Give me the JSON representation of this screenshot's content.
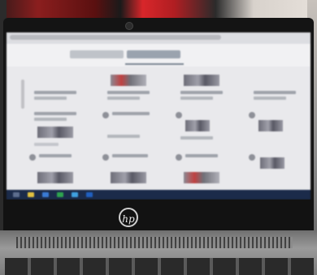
{
  "photo": {
    "subject": "laptop-screen",
    "colors": {
      "fabric_red": "#d8262a",
      "bezel": "#141414",
      "screen_bg": "#e9e9ec",
      "taskbar": "#1b2b4a"
    }
  },
  "laptop": {
    "logo_text": "hp"
  },
  "screen": {
    "cards": [
      {
        "icon": "thumbnail",
        "style": "plain"
      },
      {
        "icon": "thumbnail",
        "style": "red"
      },
      {
        "icon": "thumbnail",
        "style": "plain"
      },
      {
        "icon": "thumbnail",
        "style": "plain"
      },
      {
        "icon": "avatar",
        "style": "plain"
      },
      {
        "icon": "avatar",
        "style": "plain"
      },
      {
        "icon": "avatar",
        "style": "plain"
      },
      {
        "icon": "avatar",
        "style": "plain"
      }
    ]
  }
}
